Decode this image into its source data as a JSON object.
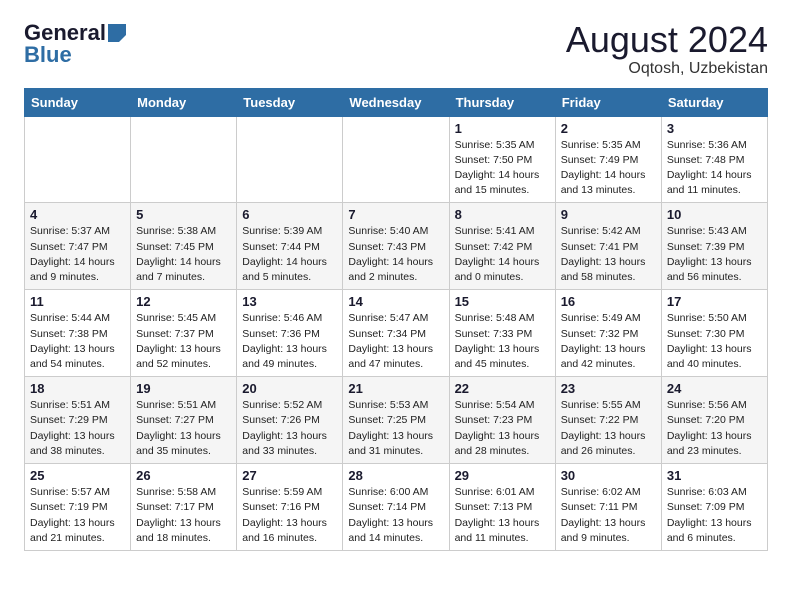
{
  "logo": {
    "general": "General",
    "blue": "Blue"
  },
  "title": "August 2024",
  "location": "Oqtosh, Uzbekistan",
  "weekdays": [
    "Sunday",
    "Monday",
    "Tuesday",
    "Wednesday",
    "Thursday",
    "Friday",
    "Saturday"
  ],
  "weeks": [
    [
      {
        "day": "",
        "info": ""
      },
      {
        "day": "",
        "info": ""
      },
      {
        "day": "",
        "info": ""
      },
      {
        "day": "",
        "info": ""
      },
      {
        "day": "1",
        "info": "Sunrise: 5:35 AM\nSunset: 7:50 PM\nDaylight: 14 hours\nand 15 minutes."
      },
      {
        "day": "2",
        "info": "Sunrise: 5:35 AM\nSunset: 7:49 PM\nDaylight: 14 hours\nand 13 minutes."
      },
      {
        "day": "3",
        "info": "Sunrise: 5:36 AM\nSunset: 7:48 PM\nDaylight: 14 hours\nand 11 minutes."
      }
    ],
    [
      {
        "day": "4",
        "info": "Sunrise: 5:37 AM\nSunset: 7:47 PM\nDaylight: 14 hours\nand 9 minutes."
      },
      {
        "day": "5",
        "info": "Sunrise: 5:38 AM\nSunset: 7:45 PM\nDaylight: 14 hours\nand 7 minutes."
      },
      {
        "day": "6",
        "info": "Sunrise: 5:39 AM\nSunset: 7:44 PM\nDaylight: 14 hours\nand 5 minutes."
      },
      {
        "day": "7",
        "info": "Sunrise: 5:40 AM\nSunset: 7:43 PM\nDaylight: 14 hours\nand 2 minutes."
      },
      {
        "day": "8",
        "info": "Sunrise: 5:41 AM\nSunset: 7:42 PM\nDaylight: 14 hours\nand 0 minutes."
      },
      {
        "day": "9",
        "info": "Sunrise: 5:42 AM\nSunset: 7:41 PM\nDaylight: 13 hours\nand 58 minutes."
      },
      {
        "day": "10",
        "info": "Sunrise: 5:43 AM\nSunset: 7:39 PM\nDaylight: 13 hours\nand 56 minutes."
      }
    ],
    [
      {
        "day": "11",
        "info": "Sunrise: 5:44 AM\nSunset: 7:38 PM\nDaylight: 13 hours\nand 54 minutes."
      },
      {
        "day": "12",
        "info": "Sunrise: 5:45 AM\nSunset: 7:37 PM\nDaylight: 13 hours\nand 52 minutes."
      },
      {
        "day": "13",
        "info": "Sunrise: 5:46 AM\nSunset: 7:36 PM\nDaylight: 13 hours\nand 49 minutes."
      },
      {
        "day": "14",
        "info": "Sunrise: 5:47 AM\nSunset: 7:34 PM\nDaylight: 13 hours\nand 47 minutes."
      },
      {
        "day": "15",
        "info": "Sunrise: 5:48 AM\nSunset: 7:33 PM\nDaylight: 13 hours\nand 45 minutes."
      },
      {
        "day": "16",
        "info": "Sunrise: 5:49 AM\nSunset: 7:32 PM\nDaylight: 13 hours\nand 42 minutes."
      },
      {
        "day": "17",
        "info": "Sunrise: 5:50 AM\nSunset: 7:30 PM\nDaylight: 13 hours\nand 40 minutes."
      }
    ],
    [
      {
        "day": "18",
        "info": "Sunrise: 5:51 AM\nSunset: 7:29 PM\nDaylight: 13 hours\nand 38 minutes."
      },
      {
        "day": "19",
        "info": "Sunrise: 5:51 AM\nSunset: 7:27 PM\nDaylight: 13 hours\nand 35 minutes."
      },
      {
        "day": "20",
        "info": "Sunrise: 5:52 AM\nSunset: 7:26 PM\nDaylight: 13 hours\nand 33 minutes."
      },
      {
        "day": "21",
        "info": "Sunrise: 5:53 AM\nSunset: 7:25 PM\nDaylight: 13 hours\nand 31 minutes."
      },
      {
        "day": "22",
        "info": "Sunrise: 5:54 AM\nSunset: 7:23 PM\nDaylight: 13 hours\nand 28 minutes."
      },
      {
        "day": "23",
        "info": "Sunrise: 5:55 AM\nSunset: 7:22 PM\nDaylight: 13 hours\nand 26 minutes."
      },
      {
        "day": "24",
        "info": "Sunrise: 5:56 AM\nSunset: 7:20 PM\nDaylight: 13 hours\nand 23 minutes."
      }
    ],
    [
      {
        "day": "25",
        "info": "Sunrise: 5:57 AM\nSunset: 7:19 PM\nDaylight: 13 hours\nand 21 minutes."
      },
      {
        "day": "26",
        "info": "Sunrise: 5:58 AM\nSunset: 7:17 PM\nDaylight: 13 hours\nand 18 minutes."
      },
      {
        "day": "27",
        "info": "Sunrise: 5:59 AM\nSunset: 7:16 PM\nDaylight: 13 hours\nand 16 minutes."
      },
      {
        "day": "28",
        "info": "Sunrise: 6:00 AM\nSunset: 7:14 PM\nDaylight: 13 hours\nand 14 minutes."
      },
      {
        "day": "29",
        "info": "Sunrise: 6:01 AM\nSunset: 7:13 PM\nDaylight: 13 hours\nand 11 minutes."
      },
      {
        "day": "30",
        "info": "Sunrise: 6:02 AM\nSunset: 7:11 PM\nDaylight: 13 hours\nand 9 minutes."
      },
      {
        "day": "31",
        "info": "Sunrise: 6:03 AM\nSunset: 7:09 PM\nDaylight: 13 hours\nand 6 minutes."
      }
    ]
  ]
}
